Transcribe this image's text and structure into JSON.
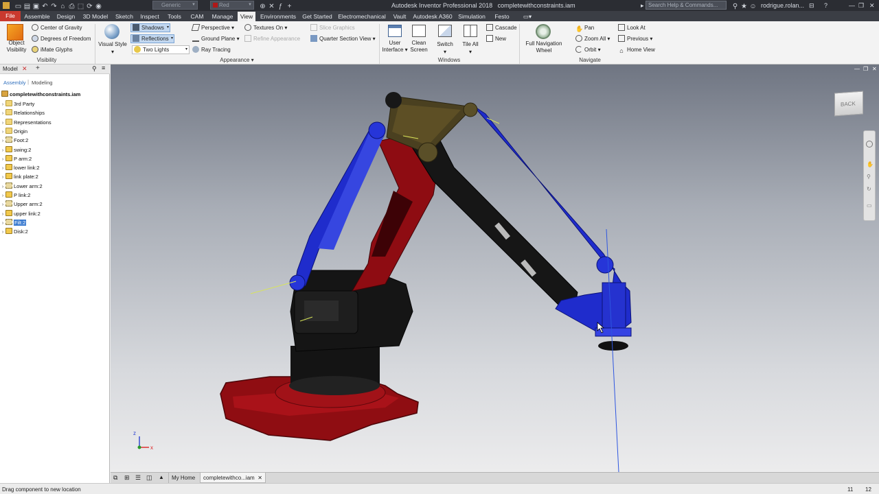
{
  "title": {
    "app": "Autodesk Inventor Professional 2018",
    "file": "completewithconstraints.iam",
    "style_combo": "Generic",
    "color_combo": "Red",
    "search_placeholder": "Search Help & Commands...",
    "user": "rodrigue.rolan..."
  },
  "tabs": [
    "File",
    "Assemble",
    "Design",
    "3D Model",
    "Sketch",
    "Inspect",
    "Tools",
    "CAM",
    "Manage",
    "View",
    "Environments",
    "Get Started",
    "Electromechanical",
    "Vault",
    "Autodesk A360",
    "Simulation",
    "Festo"
  ],
  "active_tab": "View",
  "ribbon": {
    "visibility": {
      "object_visibility": "Object Visibility",
      "center_of_gravity": "Center of Gravity",
      "degrees_of_freedom": "Degrees of Freedom",
      "imate_glyphs": "iMate Glyphs",
      "label": "Visibility"
    },
    "appearance": {
      "visual_style": "Visual Style",
      "shadows": "Shadows",
      "reflections": "Reflections",
      "lights": "Two Lights",
      "perspective": "Perspective",
      "ground_plane": "Ground Plane",
      "ray_tracing": "Ray Tracing",
      "textures_on": "Textures On",
      "refine_appearance": "Refine Appearance",
      "slice_graphics": "Slice Graphics",
      "quarter_section": "Quarter Section View",
      "label": "Appearance"
    },
    "windows": {
      "user_interface": "User Interface",
      "clean_screen": "Clean Screen",
      "switch": "Switch",
      "tile_all": "Tile All",
      "cascade": "Cascade",
      "new": "New",
      "label": "Windows"
    },
    "navigate": {
      "full_navigation_wheel": "Full Navigation Wheel",
      "pan": "Pan",
      "zoom_all": "Zoom All",
      "orbit": "Orbit",
      "look_at": "Look At",
      "previous": "Previous",
      "home_view": "Home View",
      "label": "Navigate"
    }
  },
  "browser": {
    "panel_tab": "Model",
    "mode_assembly": "Assembly",
    "mode_modeling": "Modeling",
    "root": "completewithconstraints.iam",
    "items": [
      {
        "label": "3rd Party",
        "icon": "folder-icon"
      },
      {
        "label": "Relationships",
        "icon": "folder-icon"
      },
      {
        "label": "Representations",
        "icon": "folder-icon"
      },
      {
        "label": "Origin",
        "icon": "folder-icon"
      },
      {
        "label": "Foot:2",
        "icon": "grounded-part-icon"
      },
      {
        "label": "swing:2",
        "icon": "part-icon"
      },
      {
        "label": "P arm:2",
        "icon": "part-icon"
      },
      {
        "label": "lower link:2",
        "icon": "part-icon"
      },
      {
        "label": "link plate:2",
        "icon": "part-icon"
      },
      {
        "label": "Lower arm:2",
        "icon": "grounded-part-icon"
      },
      {
        "label": "P link:2",
        "icon": "part-icon"
      },
      {
        "label": "Upper arm:2",
        "icon": "grounded-part-icon"
      },
      {
        "label": "upper link:2",
        "icon": "part-icon"
      },
      {
        "label": "Filt:2",
        "icon": "grounded-part-icon",
        "selected": true
      },
      {
        "label": "Disk:2",
        "icon": "part-icon"
      }
    ]
  },
  "viewcube": {
    "face": "BACK"
  },
  "doc_tabs": {
    "home": "My Home",
    "doc": "completewithco...iam"
  },
  "status": {
    "message": "Drag component to new location",
    "count1": "11",
    "count2": "12"
  },
  "colors": {
    "accent": "#c9392e",
    "tab_bar": "#3b3e45",
    "selection": "#3b7bd0",
    "robot_red": "#8e0c12",
    "robot_blue": "#1f2ccc",
    "robot_black": "#161616"
  }
}
